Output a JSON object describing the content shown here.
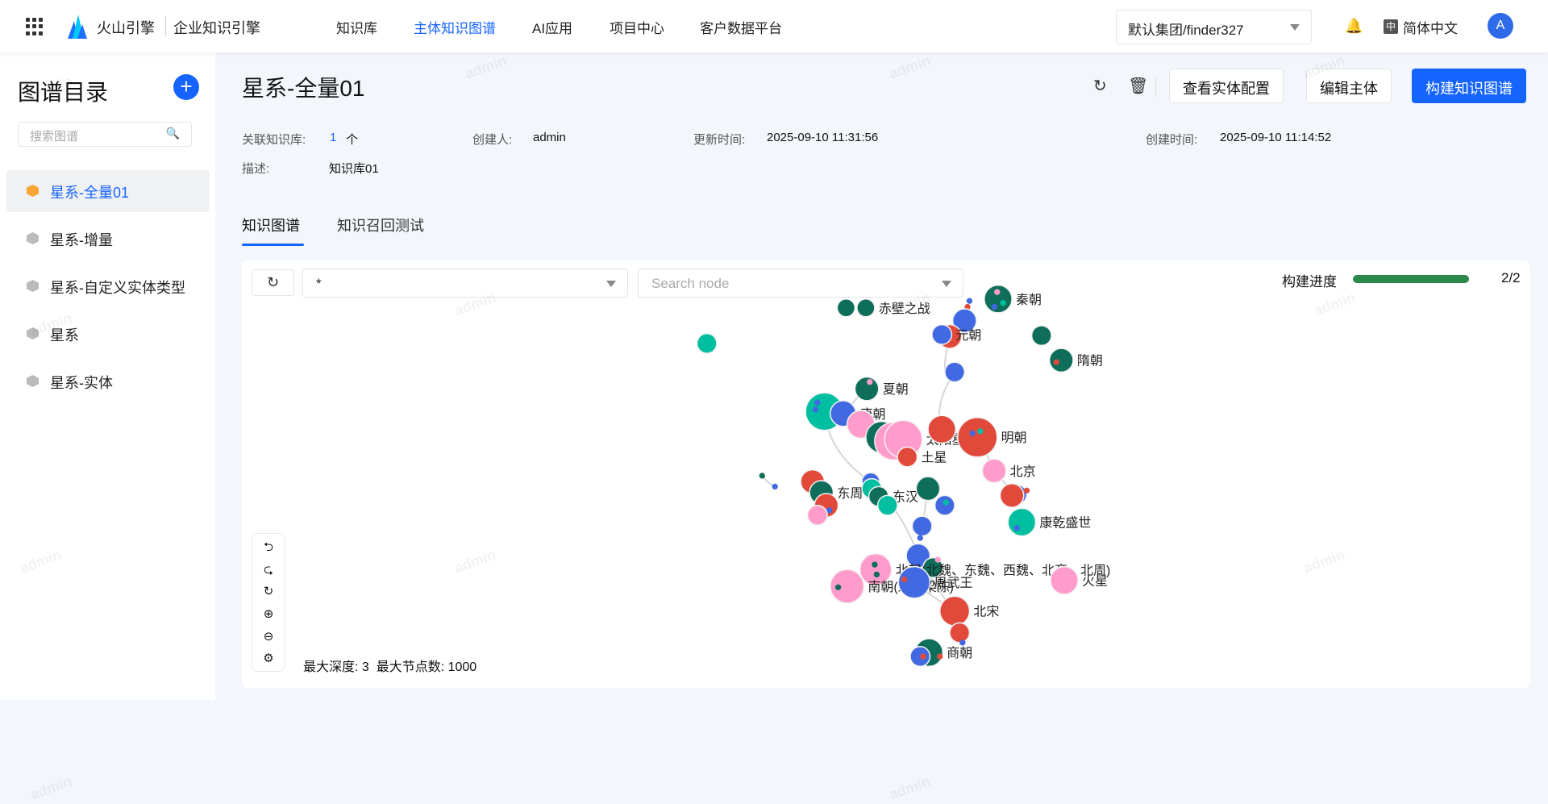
{
  "topbar": {
    "brand": "火山引擎",
    "product": "企业知识引擎",
    "nav": [
      {
        "label": "知识库",
        "active": false
      },
      {
        "label": "主体知识图谱",
        "active": true
      },
      {
        "label": "AI应用",
        "active": false
      },
      {
        "label": "项目中心",
        "active": false
      },
      {
        "label": "客户数据平台",
        "active": false
      }
    ],
    "org": "默认集团/finder327",
    "lang_icon": "中",
    "lang": "简体中文",
    "avatar": "A"
  },
  "sidebar": {
    "title": "图谱目录",
    "add": "+",
    "search_placeholder": "搜索图谱",
    "items": [
      {
        "label": "星系-全量01",
        "active": true
      },
      {
        "label": "星系-增量"
      },
      {
        "label": "星系-自定义实体类型"
      },
      {
        "label": "星系"
      },
      {
        "label": "星系-实体"
      }
    ]
  },
  "main": {
    "title": "星系-全量01",
    "buttons": {
      "view_config": "查看实体配置",
      "edit_subject": "编辑主体",
      "build": "构建知识图谱"
    },
    "meta": {
      "kb_label": "关联知识库:",
      "kb_count": "1",
      "kb_unit": "个",
      "creator_label": "创建人:",
      "creator": "admin",
      "updated_label": "更新时间:",
      "updated": "2025-09-10 11:31:56",
      "created_label": "创建时间:",
      "created": "2025-09-10 11:14:52",
      "desc_label": "描述:",
      "desc": "知识库01"
    },
    "tabs": [
      {
        "label": "知识图谱",
        "active": true
      },
      {
        "label": "知识召回测试"
      }
    ]
  },
  "graph": {
    "type_select": "*",
    "search_placeholder": "Search node",
    "progress_label": "构建进度",
    "progress_value": "2/2",
    "progress_fraction": 1.0,
    "max_depth": "最大深度: 3",
    "max_nodes": "最大节点数: 1000",
    "colors": {
      "green": "#0e6e5a",
      "teal": "#00bfa0",
      "blue": "#4169e1",
      "red": "#e14a3b",
      "pink": "#ff9ccb",
      "edge": "#d6d6d6"
    },
    "labels": [
      "赤壁之战",
      "秦朝",
      "元朝",
      "隋朝",
      "夏朝",
      "唐朝",
      "太阳星",
      "土星",
      "明朝",
      "北京",
      "康乾盛世",
      "东周",
      "东汉",
      "北朝(北魏、东魏、西魏、北齐、北周)",
      "南朝(宋齐梁陈)",
      "周武王",
      "火星",
      "北宋",
      "商朝"
    ]
  },
  "watermark": "admin"
}
